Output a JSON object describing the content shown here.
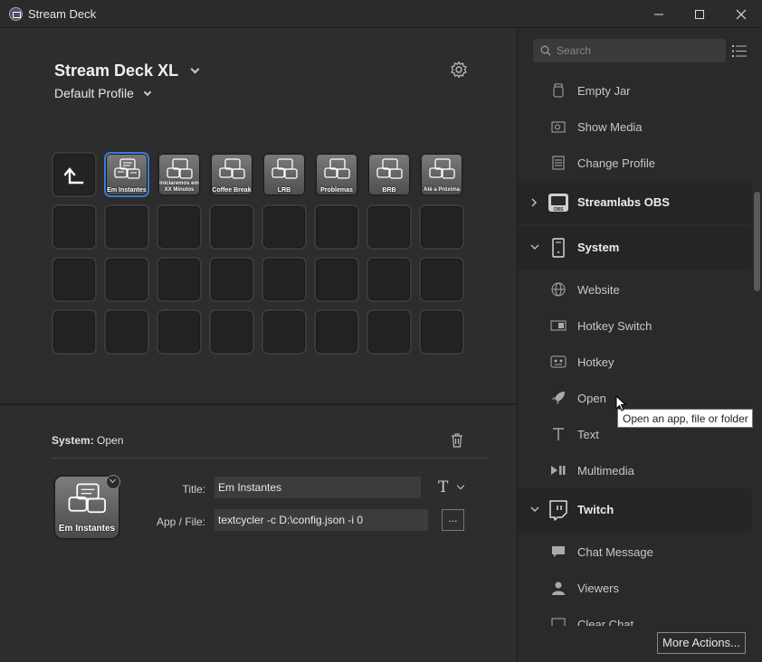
{
  "window": {
    "title": "Stream Deck",
    "minimize": "—",
    "maximize": "☐",
    "close": "✕"
  },
  "device": {
    "name": "Stream Deck XL",
    "profile": "Default Profile"
  },
  "keys": [
    "Em Instantes",
    "Iniciaremos em XX Minutos",
    "Coffee Break",
    "LRB",
    "Problemas",
    "BRB",
    "Até a Próxima"
  ],
  "properties": {
    "heading_bold": "System:",
    "heading_rest": "Open",
    "key_label": "Em Instantes",
    "title_label": "Title:",
    "title_value": "Em Instantes",
    "file_label": "App / File:",
    "file_value": "textcycler -c D:\\config.json -i 0",
    "browse_label": "...",
    "title_format_icon": "T"
  },
  "sidebar": {
    "search_placeholder": "Search",
    "items": {
      "empty_jar": "Empty Jar",
      "show_media": "Show Media",
      "change_profile": "Change Profile",
      "cat_streamlabs": "Streamlabs OBS",
      "streamlabs_badge": "OBS",
      "cat_system": "System",
      "website": "Website",
      "hotkey_switch": "Hotkey Switch",
      "hotkey": "Hotkey",
      "open": "Open",
      "text": "Text",
      "multimedia": "Multimedia",
      "cat_twitch": "Twitch",
      "chat_message": "Chat Message",
      "viewers": "Viewers",
      "clear_chat": "Clear Chat"
    },
    "more_actions": "More Actions...",
    "tooltip": "Open an app, file or folder"
  },
  "colors": {
    "accent": "#3a7bd5",
    "background": "#2d2d2d",
    "panel": "#2a2a2a"
  }
}
